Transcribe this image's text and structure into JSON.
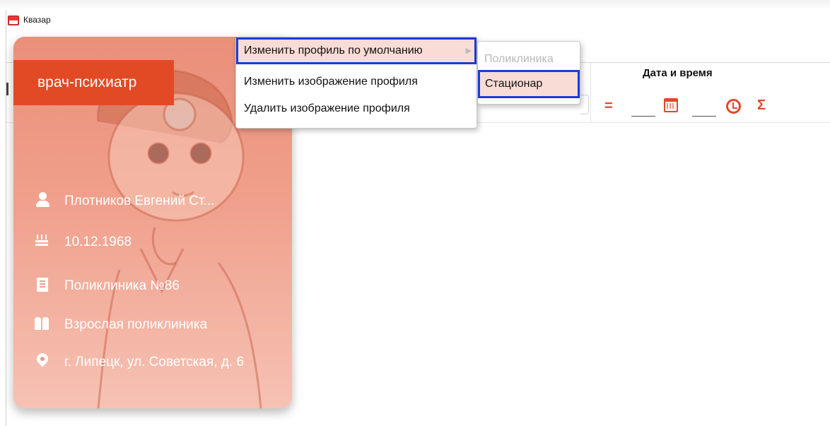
{
  "app": {
    "title": "Квазар"
  },
  "columns": {
    "datetime_title": "Дата и время"
  },
  "filters": {
    "equals_symbol": "=",
    "sum_symbol": "Σ",
    "calendar_icon": "calendar-icon",
    "clock_icon": "clock-icon"
  },
  "profile": {
    "role": "врач-психиатр",
    "name": "Плотников Евгений Ст...",
    "birth_date": "10.12.1968",
    "organization": "Поликлиника №86",
    "department": "Взрослая поликлиника",
    "address": "г. Липецк, ул. Советская, д. 6"
  },
  "context_menu": {
    "items": [
      {
        "label": "Изменить профиль по умолчанию",
        "has_submenu": true,
        "highlighted": true
      },
      {
        "label": "Изменить изображение профиля",
        "has_submenu": false,
        "highlighted": false
      },
      {
        "label": "Удалить изображение профиля",
        "has_submenu": false,
        "highlighted": false
      }
    ],
    "submenu": [
      {
        "label": "Поликлиника",
        "enabled": false
      },
      {
        "label": "Стационар",
        "enabled": true,
        "highlighted": true
      }
    ]
  },
  "colors": {
    "accent": "#e24a25",
    "highlight_border": "#1a3be0",
    "highlight_fill": "#f9dcd6"
  }
}
